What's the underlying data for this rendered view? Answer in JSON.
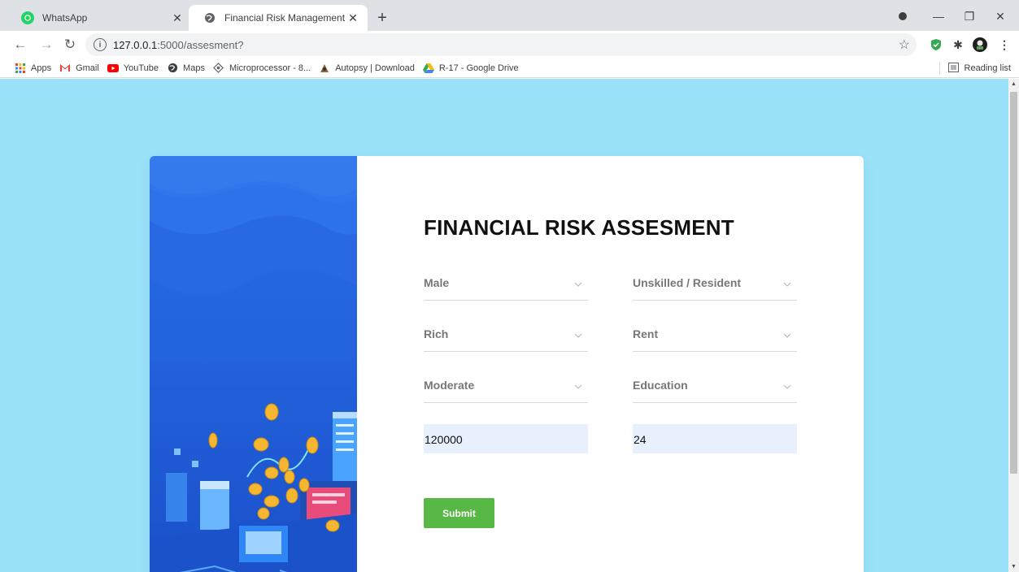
{
  "browser": {
    "tabs": [
      {
        "title": "WhatsApp",
        "active": false
      },
      {
        "title": "Financial Risk Management",
        "active": true
      }
    ],
    "url_host": "127.0.0.1",
    "url_path": ":5000/assesment?",
    "bookmarks": [
      {
        "label": "Apps",
        "icon": "apps-grid-icon"
      },
      {
        "label": "Gmail",
        "icon": "gmail-icon"
      },
      {
        "label": "YouTube",
        "icon": "youtube-icon"
      },
      {
        "label": "Maps",
        "icon": "globe-icon"
      },
      {
        "label": "Microprocessor - 8...",
        "icon": "chip-icon"
      },
      {
        "label": "Autopsy | Download",
        "icon": "autopsy-icon"
      },
      {
        "label": "R-17 - Google Drive",
        "icon": "drive-icon"
      }
    ],
    "reading_list": "Reading list"
  },
  "page": {
    "background": "#99e2fa",
    "title": "FINANCIAL RISK ASSESMENT",
    "fields": {
      "sex": "Male",
      "job": "Unskilled / Resident",
      "saving_accounts": "Rich",
      "housing": "Rent",
      "checking_account": "Moderate",
      "purpose": "Education",
      "credit_amount": "120000",
      "duration": "24"
    },
    "submit_label": "Submit",
    "accent": "#57b846"
  }
}
